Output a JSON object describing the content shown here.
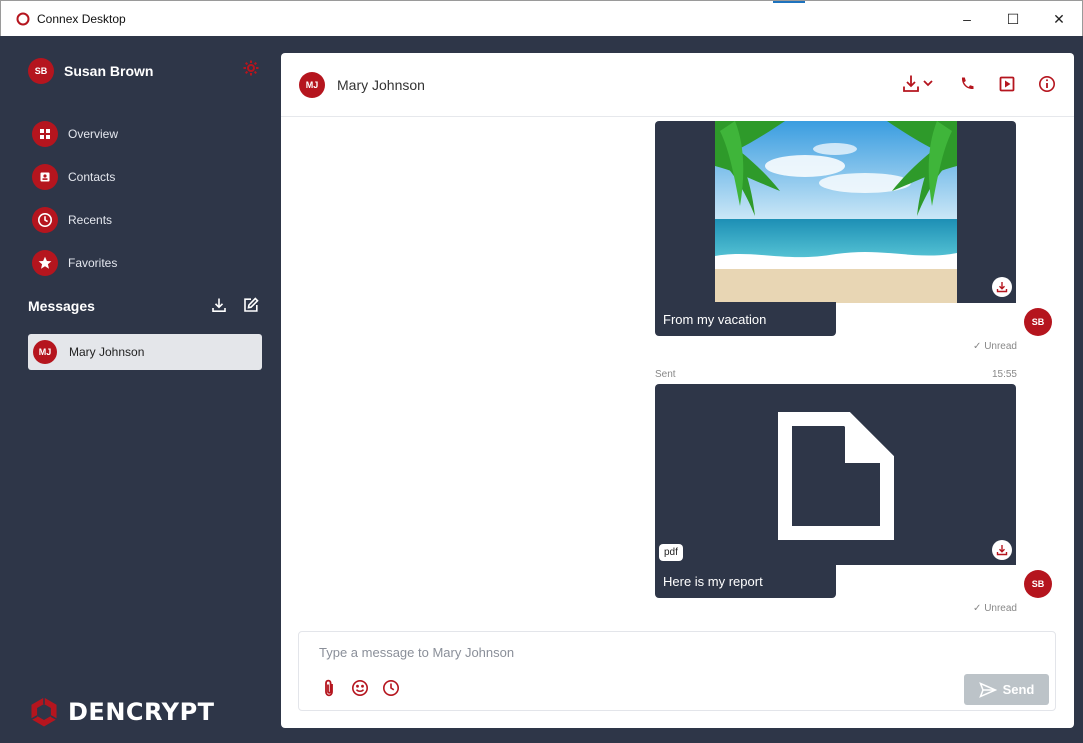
{
  "window": {
    "title": "Connex Desktop",
    "minimize_glyph": "–",
    "maximize_glyph": "☐",
    "close_glyph": "✕"
  },
  "colors": {
    "brand_red": "#b5151e",
    "sidebar_bg": "#2e3648",
    "send_disabled": "#bcc3c8"
  },
  "user": {
    "initials": "SB",
    "name": "Susan Brown"
  },
  "nav": [
    {
      "label": "Overview",
      "icon": "grid-icon"
    },
    {
      "label": "Contacts",
      "icon": "contact-card-icon"
    },
    {
      "label": "Recents",
      "icon": "clock-icon"
    },
    {
      "label": "Favorites",
      "icon": "star-icon"
    }
  ],
  "messages": {
    "title": "Messages",
    "conversations": [
      {
        "initials": "MJ",
        "name": "Mary Johnson"
      }
    ]
  },
  "logo": {
    "text": "DENCRYPT"
  },
  "chat": {
    "contact_initials": "MJ",
    "contact_name": "Mary Johnson",
    "items": [
      {
        "type": "image",
        "caption": "From my vacation",
        "status": "✓ Unread",
        "sender_initials": "SB"
      },
      {
        "type": "file",
        "meta_left": "Sent",
        "meta_right": "15:55",
        "file_ext": "pdf",
        "caption": "Here is my report",
        "status": "✓ Unread",
        "sender_initials": "SB"
      }
    ]
  },
  "composer": {
    "placeholder": "Type a message to Mary Johnson",
    "value": "",
    "send_label": "Send"
  }
}
